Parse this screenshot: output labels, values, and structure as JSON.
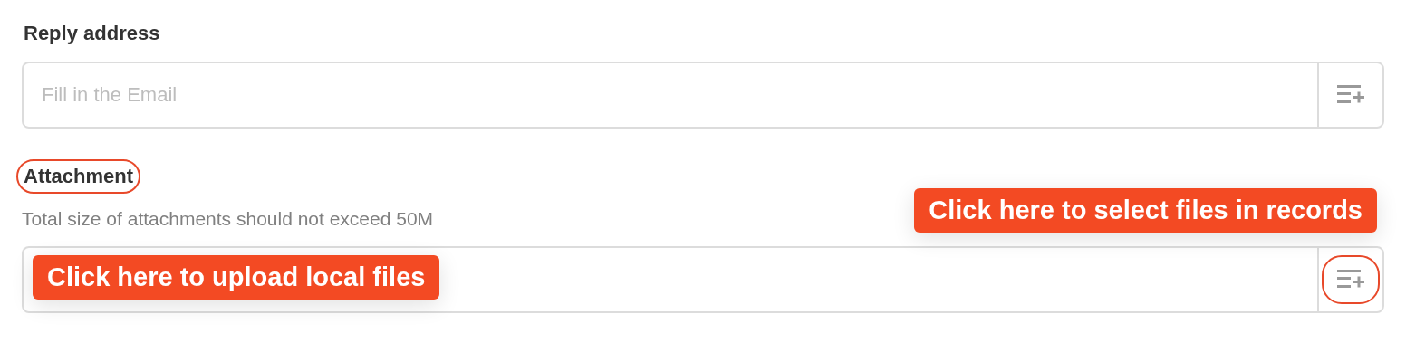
{
  "sections": [
    {
      "label": "Reply address",
      "label_highlighted": false,
      "field": {
        "placeholder": "Fill in the Email",
        "button_highlighted": false
      }
    },
    {
      "label": "Attachment",
      "label_highlighted": true,
      "note": "Total size of attachments should not exceed 50M",
      "field": {
        "button_highlighted": true,
        "callouts": [
          {
            "text": "Click here to upload local files",
            "kind": "inside"
          },
          {
            "text": "Click here to select files in records",
            "kind": "above-right"
          }
        ]
      }
    }
  ]
}
